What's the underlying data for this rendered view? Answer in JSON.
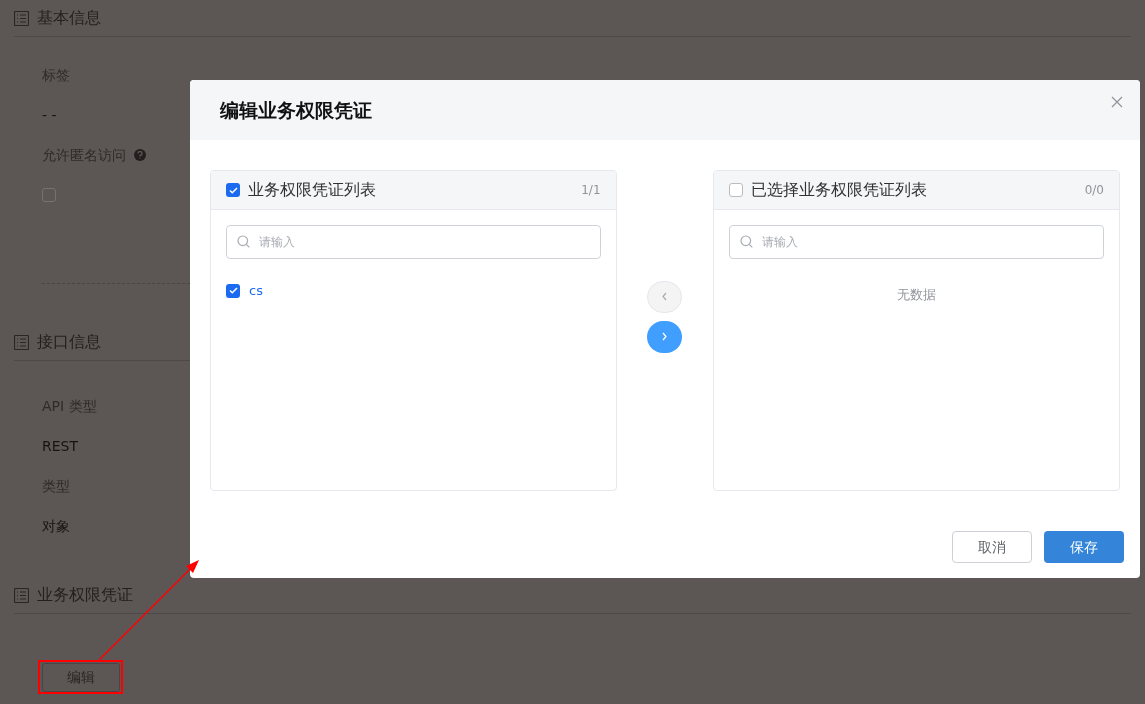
{
  "page": {
    "sections": [
      {
        "title": "基本信息",
        "fields": [
          {
            "kind": "text",
            "label": "标签",
            "value": "- -"
          },
          {
            "kind": "checkbox",
            "label": "允许匿名访问",
            "help": true,
            "checked": false
          }
        ]
      },
      {
        "title": "接口信息",
        "fields": [
          {
            "kind": "text",
            "label": "API 类型",
            "value": "REST"
          },
          {
            "kind": "text",
            "label": "类型",
            "value": "对象"
          }
        ]
      },
      {
        "title": "业务权限凭证",
        "button": "编辑"
      }
    ]
  },
  "dialog": {
    "title": "编辑业务权限凭证",
    "panels": [
      {
        "title": "业务权限凭证列表",
        "checked": true,
        "count": "1/1",
        "placeholder": "请输入",
        "items": [
          {
            "label": "cs",
            "checked": true
          }
        ]
      },
      {
        "title": "已选择业务权限凭证列表",
        "checked": false,
        "count": "0/0",
        "placeholder": "请输入",
        "empty_text": "无数据"
      }
    ],
    "transfer_buttons": [
      {
        "kind": "left",
        "disabled": true
      },
      {
        "kind": "right",
        "disabled": false
      }
    ],
    "buttons": [
      {
        "label": "取消",
        "kind": "default"
      },
      {
        "label": "保存",
        "kind": "primary"
      }
    ]
  }
}
